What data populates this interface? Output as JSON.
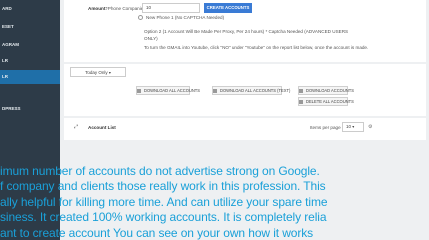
{
  "sidebar": {
    "items": [
      {
        "label": "ARD"
      },
      {
        "label": "ESET"
      },
      {
        "label": "AGRAM"
      },
      {
        "label": "LR"
      },
      {
        "label": "LR"
      },
      {
        "label": "DPRESS"
      }
    ]
  },
  "form": {
    "amount_label": "Amount:",
    "phone_label": "*Phone Companies:",
    "amount_value": "10",
    "create_button": "CREATE ACCOUNTS",
    "option1": "New Phone 1 (No CAPTCHA Needed)",
    "option2_line1": "Option 2 (1 Account Will Be Made Per Proxy, Per 24 hours) * Captcha Needed (ADVANCED USERS",
    "option2_line2": "ONLY)",
    "gmail_note": "To turn the GMAIL into Youtube, click \"NO\" under \"Youtube\" on the report list below, once the account is made."
  },
  "filter": {
    "date_select": "Today Only"
  },
  "downloads": {
    "all_accounts": "DOWNLOAD ALL ACCOUNTS",
    "all_accounts_text": "DOWNLOAD ALL ACCOUNTS (TEXT)",
    "accounts": "DOWNLOAD ACCOUNTS",
    "delete_all": "DELETE ALL ACCOUNTS"
  },
  "account_list": {
    "title": "Account List",
    "items_per_page_label": "Items per page",
    "items_per_page_value": "10"
  },
  "caption": {
    "line1": "imum number of accounts do not advertise strong on Google.",
    "line2": "f company and clients those really work in this profession. This",
    "line3": "ally helpful for killing more time. And can utilize your spare time",
    "line4": "siness. It created 100% working accounts. It is completely relia",
    "line5": "ant to create account   You can see on your own how it works"
  },
  "colors": {
    "sidebar": "#2d3b48",
    "active": "#1f6fa8",
    "primary_button": "#3a7bd5",
    "caption": "#1aa0d8"
  }
}
